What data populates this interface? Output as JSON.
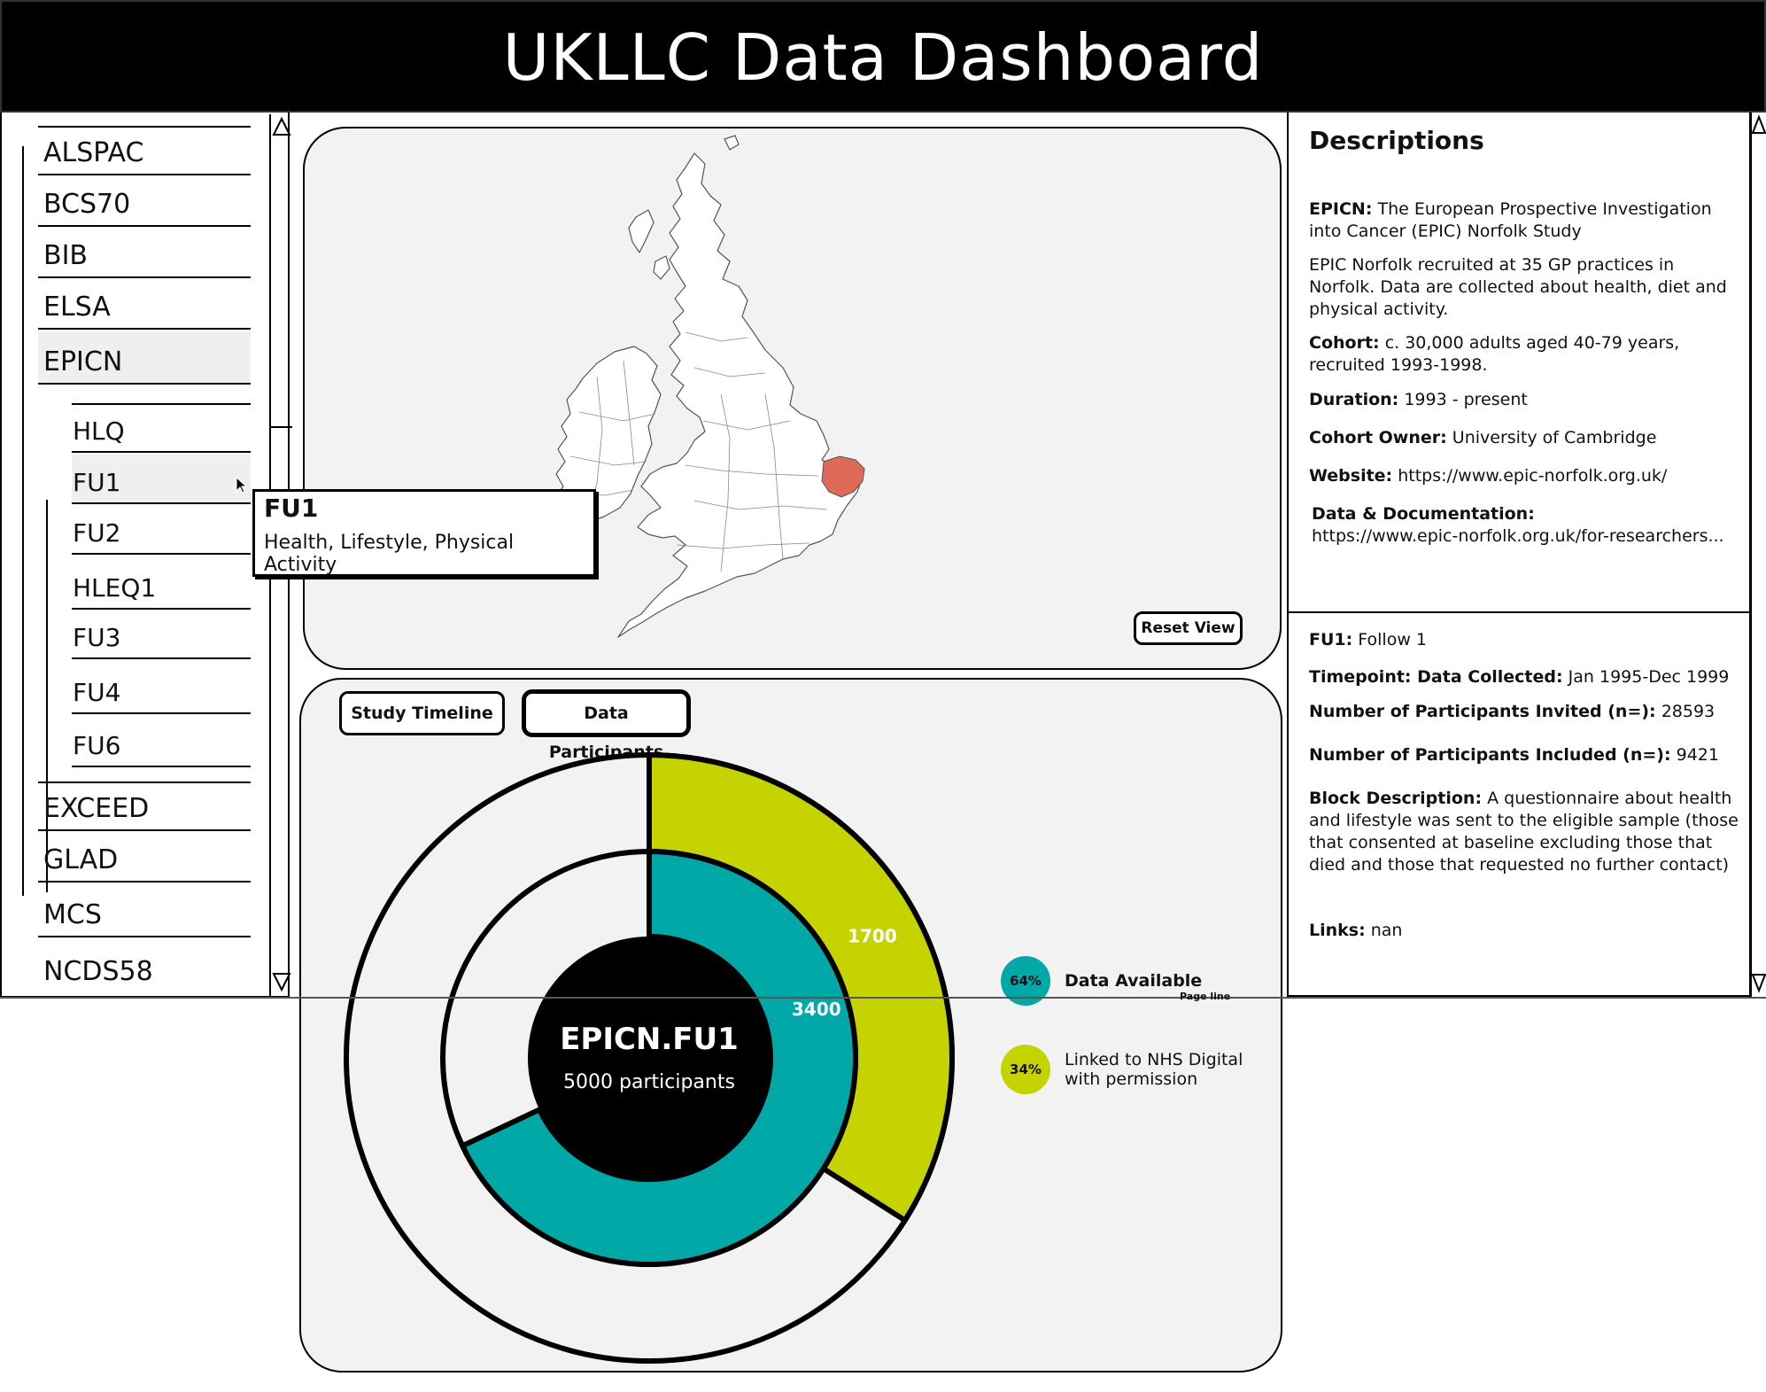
{
  "header": {
    "title": "UKLLC Data Dashboard"
  },
  "sidebar": {
    "studies_top": [
      "ALSPAC",
      "BCS70",
      "BIB",
      "ELSA",
      "EPICN"
    ],
    "selected_study": "EPICN",
    "sub_items": [
      "HLQ",
      "FU1",
      "FU2",
      "HLEQ1",
      "FU3",
      "FU4",
      "FU6"
    ],
    "hovered_sub_item": "FU1",
    "studies_bottom": [
      "EXCEED",
      "GLAD",
      "MCS",
      "NCDS58"
    ],
    "scroll_up_icon": "triangle-up-outline",
    "scroll_down_icon": "triangle-down-outline"
  },
  "tooltip": {
    "title": "FU1",
    "text": "Health, Lifestyle, Physical Activity"
  },
  "map": {
    "reset_label": "Reset View",
    "highlight_color": "#e06a5a",
    "highlight_region": "Norfolk"
  },
  "chart_tabs": {
    "timeline_label": "Study Timeline",
    "participants_label": "Data Participants",
    "active": "Data Participants"
  },
  "chart_data": {
    "type": "pie",
    "center_title": "EPICN.FU1",
    "center_subtitle": "5000 participants",
    "total": 5000,
    "rings": [
      {
        "ring": "inner",
        "name": "Data Available",
        "value": 3400,
        "label": "3400",
        "color": "#00a8a8"
      },
      {
        "ring": "outer",
        "name": "Linked to NHS Digital with permission",
        "value": 1700,
        "label": "1700",
        "color": "#c5d400"
      }
    ],
    "legend": [
      {
        "pct": "64%",
        "label": "Data Available",
        "color": "#00a8a8"
      },
      {
        "pct": "34%",
        "label": "Linked to NHS Digital with permission",
        "color": "#c5d400"
      }
    ]
  },
  "page_line_label": "Page line",
  "descriptions": {
    "heading": "Descriptions",
    "study_name_label": "EPICN:",
    "study_name": "The European Prospective Investigation into Cancer (EPIC) Norfolk Study",
    "summary": "EPIC Norfolk recruited at 35 GP practices in Norfolk. Data are collected about health, diet and physical activity.",
    "cohort_label": "Cohort:",
    "cohort": "c. 30,000 adults aged 40-79 years, recruited 1993-1998.",
    "duration_label": "Duration:",
    "duration": "1993 - present",
    "owner_label": "Cohort Owner:",
    "owner": "University of Cambridge",
    "website_label": "Website:",
    "website": "https://www.epic-norfolk.org.uk/",
    "docs_label": "Data & Documentation:",
    "docs": "https://www.epic-norfolk.org.uk/for-researchers..."
  },
  "block": {
    "fu_label": "FU1:",
    "fu_value": "Follow 1",
    "timepoint_label": "Timepoint: Data Collected:",
    "timepoint": "Jan 1995-Dec 1999",
    "invited_label": "Number of Participants Invited (n=):",
    "invited": "28593",
    "included_label": "Number of Participants Included (n=):",
    "included": "9421",
    "desc_label": "Block Description:",
    "desc": "A questionnaire about health and lifestyle was sent to the eligible sample (those that consented at baseline excluding those that died and those that requested no further contact)",
    "links_label": "Links:",
    "links": "nan"
  }
}
